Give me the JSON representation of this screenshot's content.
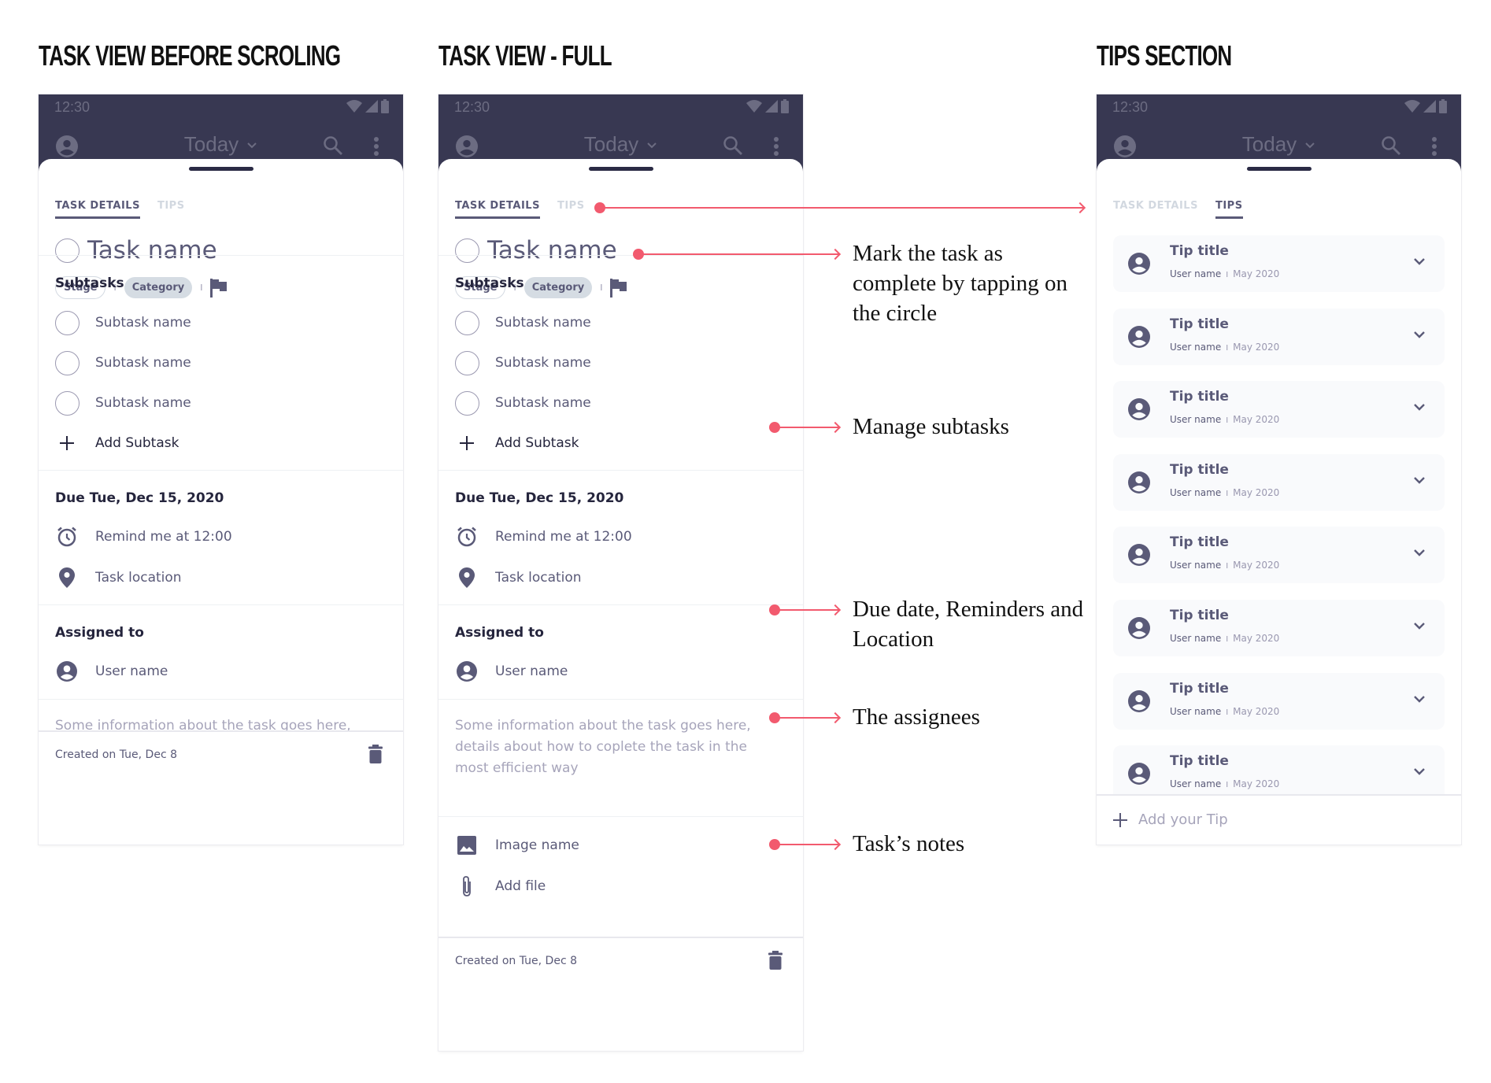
{
  "sections": {
    "before_scroll": "TASK VIEW BEFORE SCROLING",
    "full": "TASK VIEW - FULL",
    "tips": "TIPS SECTION"
  },
  "status_bar": {
    "time": "12:30"
  },
  "app_bar": {
    "title": "Today"
  },
  "tabs": {
    "details": "TASK DETAILS",
    "tips": "TIPS"
  },
  "task": {
    "name": "Task name",
    "stage": "Stage",
    "category": "Category",
    "separator": "I"
  },
  "subtasks": {
    "label": "Subtasks",
    "items": [
      "Subtask name",
      "Subtask name",
      "Subtask name"
    ],
    "add_label": "Add Subtask"
  },
  "due": {
    "label": "Due Tue, Dec 15, 2020",
    "reminder": "Remind me at 12:00",
    "location": "Task location"
  },
  "assigned": {
    "label": "Assigned to",
    "user": "User name"
  },
  "notes": {
    "text": "Some information about the task goes here, details about how to coplete the task in the most efficient way",
    "line1": "Some information about the task goes here,",
    "line2": "details about how to coplete the task in the",
    "line3": "most efficient way"
  },
  "attachments": {
    "image": "Image name",
    "file": "Add file"
  },
  "footer": {
    "created": "Created on Tue, Dec 8"
  },
  "tips": {
    "items": [
      {
        "title": "Tip title",
        "user": "User name",
        "date": "May 2020"
      },
      {
        "title": "Tip title",
        "user": "User name",
        "date": "May 2020"
      },
      {
        "title": "Tip title",
        "user": "User name",
        "date": "May 2020"
      },
      {
        "title": "Tip title",
        "user": "User name",
        "date": "May 2020"
      },
      {
        "title": "Tip title",
        "user": "User name",
        "date": "May 2020"
      },
      {
        "title": "Tip title",
        "user": "User name",
        "date": "May 2020"
      },
      {
        "title": "Tip title",
        "user": "User name",
        "date": "May 2020"
      },
      {
        "title": "Tip title",
        "user": "User name",
        "date": "May 2020"
      }
    ],
    "separator": "I",
    "add_label": "Add your Tip"
  },
  "annotations": {
    "mark_complete": "Mark the task as complete by tapping on the circle",
    "subtasks": "Manage subtasks",
    "due": "Due date, Reminders and Location",
    "assignees": "The assignees",
    "notes": "Task’s notes"
  },
  "colors": {
    "app_bar": "#383852",
    "accent": "#f25a6e",
    "primary_text": "#5a5a78",
    "dark_text": "#25253d"
  }
}
